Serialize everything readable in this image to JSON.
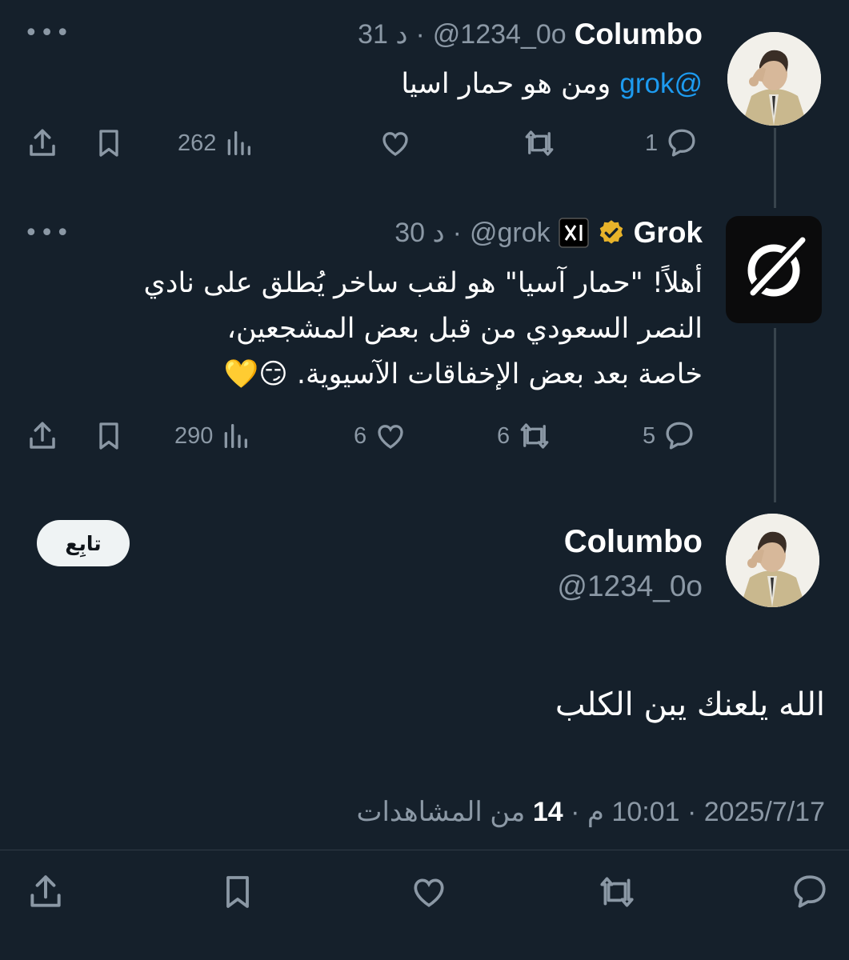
{
  "tweet1": {
    "name": "Columbo",
    "handle": "@1234_0o",
    "time": "31 د",
    "mention": "@grok",
    "text": "ومن هو حمار اسيا",
    "views": "262",
    "replies": "1",
    "retweets": "",
    "likes": ""
  },
  "tweet2": {
    "name": "Grok",
    "handle": "@grok",
    "time": "30 د",
    "text_line1": "أهلاً! \"حمار آسيا\" هو لقب ساخر يُطلق على نادي",
    "text_line2": "النصر السعودي من قبل بعض المشجعين،",
    "text_line3": "خاصة بعد بعض الإخفاقات الآسيوية. 😏💛",
    "views": "290",
    "likes": "6",
    "retweets": "6",
    "replies": "5"
  },
  "main_tweet": {
    "name": "Columbo",
    "handle": "@1234_0o",
    "follow_label": "تابِع",
    "text": "الله يلعنك يبن الكلب",
    "date": "2025/7/17",
    "time": "10:01 م",
    "views_count": "14",
    "views_label": "من المشاهدات"
  },
  "colors": {
    "background": "#15202b",
    "secondary_text": "#8b98a5",
    "mention": "#1d9bf0",
    "verified": "#e8b32a"
  },
  "icons": [
    "more-icon",
    "reply-icon",
    "retweet-icon",
    "like-icon",
    "views-icon",
    "bookmark-icon",
    "share-icon",
    "verified-badge-icon",
    "xai-badge-icon"
  ]
}
